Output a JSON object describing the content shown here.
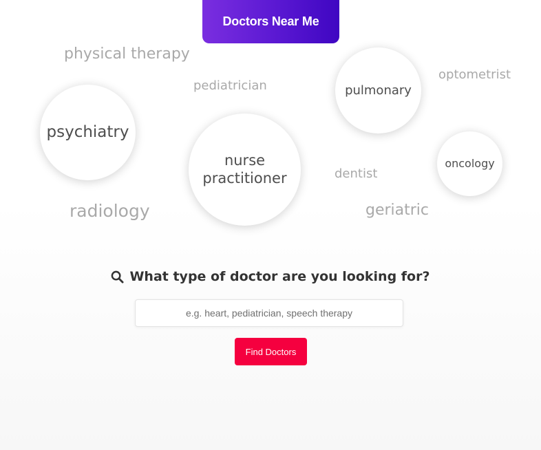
{
  "brand": {
    "title": "Doctors Near Me"
  },
  "specialties": {
    "physical_therapy": "physical therapy",
    "pediatrician": "pediatrician",
    "optometrist": "optometrist",
    "dentist": "dentist",
    "radiology": "radiology",
    "geriatric": "geriatric",
    "psychiatry": "psychiatry",
    "nurse_practitioner_line1": "nurse",
    "nurse_practitioner_line2": "practitioner",
    "pulmonary": "pulmonary",
    "oncology": "oncology"
  },
  "search": {
    "heading": "What type of doctor are you looking for?",
    "placeholder": "e.g. heart, pediatrician, speech therapy",
    "value": "",
    "button_label": "Find Doctors",
    "icon": "search-icon"
  },
  "colors": {
    "brand_gradient_start": "#7a2ee0",
    "brand_gradient_end": "#3f06c2",
    "button": "#f5003f",
    "floating_label": "#a9a9a9",
    "bubble_text": "#4e4e4e",
    "heading_text": "#333333"
  }
}
